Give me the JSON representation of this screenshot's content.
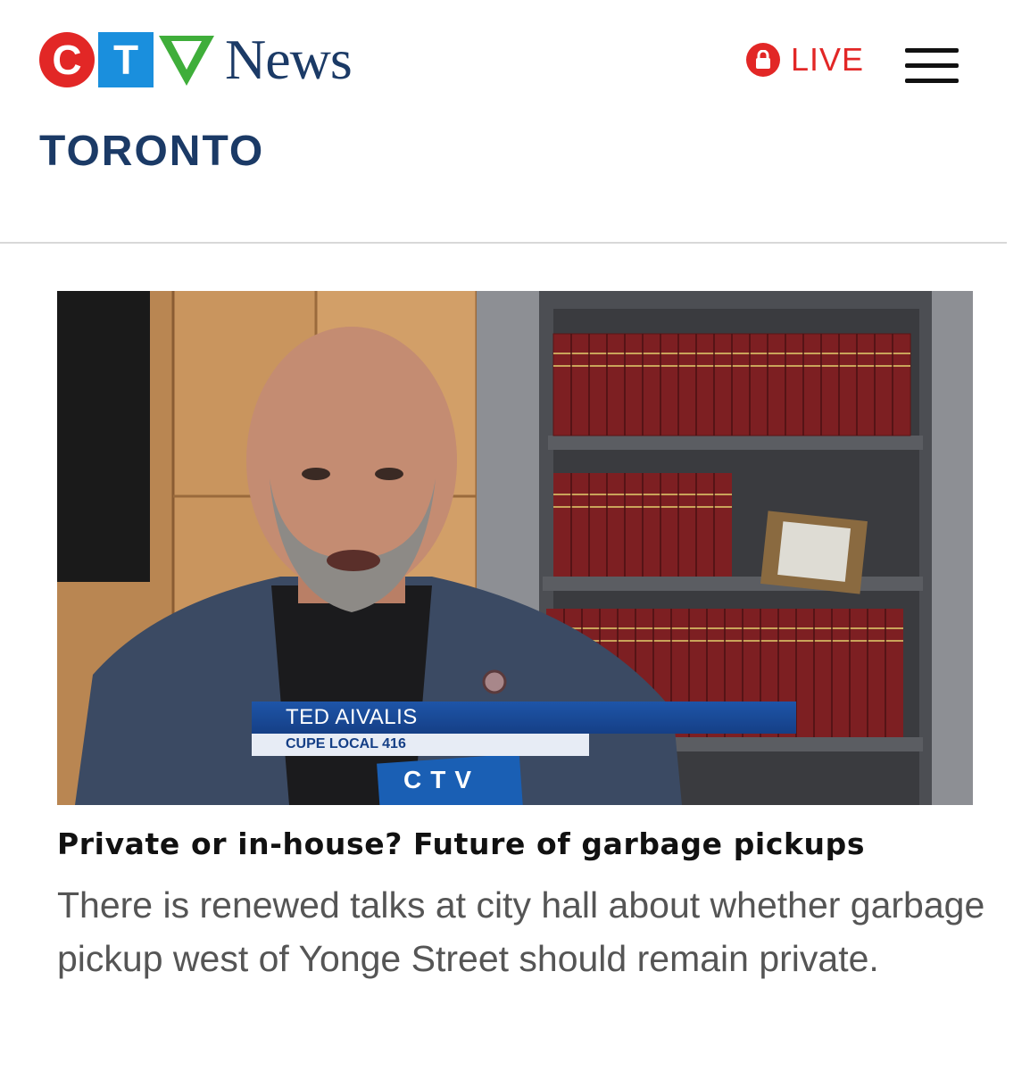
{
  "header": {
    "logo": {
      "letters": [
        "C",
        "T",
        "V"
      ],
      "wordmark": "News",
      "colors": {
        "c": "#e22726",
        "t": "#1a8fdd",
        "v": "#3fae3a",
        "news": "#1b3a66"
      }
    },
    "region": "TORONTO",
    "live_label": "LIVE",
    "live_icon": "lock-icon",
    "menu_icon": "hamburger-menu-icon"
  },
  "article": {
    "image": {
      "lower_third_name": "TED AIVALIS",
      "lower_third_org": "CUPE LOCAL 416",
      "mic_flag_text": "CTV"
    },
    "headline": "Private or in-house? Future of garbage pickups",
    "summary": "There is renewed talks at city hall about whether garbage pickup west of Yonge Street should remain private."
  }
}
